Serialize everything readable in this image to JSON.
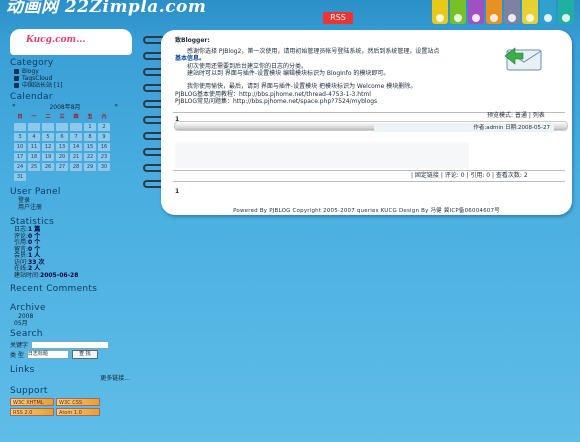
{
  "header": {
    "title": "动画网 22Zimpla.com",
    "rss_label": "RSS"
  },
  "topnav": {
    "tabs": [
      {
        "color": "#e8c818"
      },
      {
        "color": "#78c028"
      },
      {
        "color": "#a050c0"
      },
      {
        "color": "#e89020"
      },
      {
        "color": "#8080a0"
      },
      {
        "color": "#e8d030"
      },
      {
        "color": "#30a0d0"
      },
      {
        "color": "#20b0a0"
      }
    ]
  },
  "sidebar": {
    "logo": "Kucg.com...",
    "logo_sub": "",
    "category": {
      "title": "Category",
      "items": [
        "Blogy",
        "TagsCloud",
        "中国站长站 [1]"
      ]
    },
    "calendar": {
      "title": "Calendar",
      "month": "2008年8月",
      "prev": "«",
      "next": "»",
      "weekdays": [
        "日",
        "一",
        "二",
        "三",
        "四",
        "五",
        "六"
      ],
      "days": [
        "",
        "",
        "",
        "",
        "",
        "1",
        "2",
        "3",
        "4",
        "5",
        "6",
        "7",
        "8",
        "9",
        "10",
        "11",
        "12",
        "13",
        "14",
        "15",
        "16",
        "17",
        "18",
        "19",
        "20",
        "21",
        "22",
        "23",
        "24",
        "25",
        "26",
        "27",
        "28",
        "29",
        "30",
        "31"
      ]
    },
    "userpanel": {
      "title": "User Panel",
      "items": [
        "登录",
        "用户注册"
      ]
    },
    "statistics": {
      "title": "Statistics",
      "rows": [
        {
          "k": "日志:",
          "v": "1 篇"
        },
        {
          "k": "评论:",
          "v": "0 个"
        },
        {
          "k": "引用:",
          "v": "0 个"
        },
        {
          "k": "留言:",
          "v": "0 个"
        },
        {
          "k": "会员:",
          "v": "1 人"
        },
        {
          "k": "访问:",
          "v": "33 次"
        },
        {
          "k": "在线:",
          "v": "2 人"
        },
        {
          "k": "建站时间:",
          "v": "2005-06-28"
        }
      ]
    },
    "recent_comments": {
      "title": "Recent Comments"
    },
    "archive": {
      "title": "Archive",
      "year": "2008",
      "month": "05月"
    },
    "search": {
      "title": "Search",
      "keyword_label": "关键字",
      "type_label": "类 型",
      "select_value": "日志标题",
      "button": "查 找"
    },
    "links": {
      "title": "Links",
      "more": "更多链接..."
    },
    "support": {
      "title": "Support",
      "badges": [
        "W3C XHTML 1.0",
        "W3C CSS",
        "RSS 2.0",
        "Atom 1.0"
      ]
    }
  },
  "main": {
    "greeting": "致Blogger:",
    "para1a": "感谢你选择 PJBlog2，第一次使用，请用初始管理员帐号登陆系统，然后到系统管理，设置站点",
    "para1b": "基本信息。",
    "para2a": "初次使用还需要到后台建立你的日志的分类。",
    "para2b": "建站时可以到 界面与插件-设置模块 编辑模块标识为 BlogInfo 的模块即可。",
    "para3": "我你使用愉快，最后，请到 界面与插件-设置模块 把模块标识为 Welcome 模块删除。",
    "link1": "PJBLOG基本使用教程：http://bbs.pjhome.net/thread-4753-1-3.html",
    "link2": "PJBLOG常见问题集：http://bbs.pjhome.net/space.php?7524/myblogs",
    "post_number": "1",
    "view_mode": "预览模式: 普通 | 列表",
    "author_line": "作者:admin 日期:2008-05-27",
    "post_actions": "| 固定链接 | 评论: 0 | 引用: 0 | 查看次数: 2",
    "page_number": "1",
    "footer": "Powered By PJBLOG Copyright 2005-2007 queries KUCG Design By 冯健 冀ICP备06004607号"
  }
}
